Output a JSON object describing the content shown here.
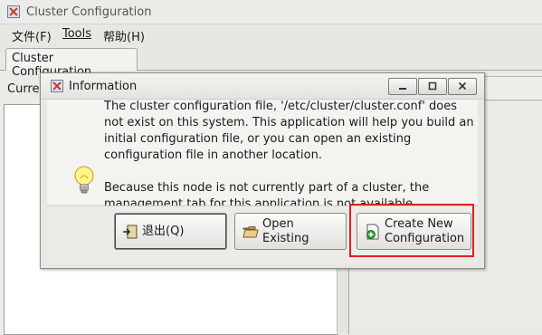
{
  "window": {
    "title": "Cluster Configuration"
  },
  "menubar": {
    "file": {
      "label": "文件",
      "mnemonic": "(F)"
    },
    "tools": {
      "label": "Tools"
    },
    "help": {
      "label": "帮助",
      "mnemonic": "(H)"
    }
  },
  "tabs": [
    {
      "label": "Cluster Configuration"
    }
  ],
  "main": {
    "current_label": "Curre"
  },
  "dialog": {
    "title": "Information",
    "message": [
      "The cluster configuration file, '/etc/cluster/cluster.conf' does not exist on this system. This application will help you build an initial configuration file, or you can open an existing configuration file in another location.",
      "Because this node is not currently part of a cluster, the management tab for this application is not available."
    ],
    "icon": "lightbulb-icon",
    "buttons": {
      "quit": {
        "label": "退出",
        "mnemonic": "(Q)"
      },
      "open_existing": {
        "line1": "Open",
        "line2": "Existing"
      },
      "create_new": {
        "line1": "Create New",
        "line2": "Configuration"
      }
    }
  },
  "highlight_color": "#e0201c"
}
